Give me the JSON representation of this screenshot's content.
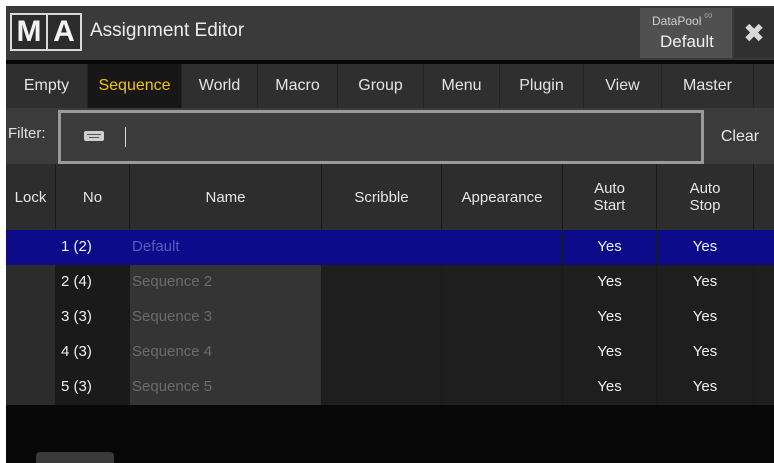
{
  "window": {
    "logo_m": "M",
    "logo_a": "A",
    "title": "Assignment Editor",
    "datapool_label": "DataPool",
    "datapool_value": "Default",
    "close_glyph": "✖"
  },
  "tabs": [
    {
      "label": "Empty",
      "active": false
    },
    {
      "label": "Sequence",
      "active": true
    },
    {
      "label": "World",
      "active": false
    },
    {
      "label": "Macro",
      "active": false
    },
    {
      "label": "Group",
      "active": false
    },
    {
      "label": "Menu",
      "active": false
    },
    {
      "label": "Plugin",
      "active": false
    },
    {
      "label": "View",
      "active": false
    },
    {
      "label": "Master",
      "active": false
    }
  ],
  "filter": {
    "label": "Filter:",
    "value": "",
    "clear_label": "Clear"
  },
  "table": {
    "columns": {
      "lock": "Lock",
      "no": "No",
      "name": "Name",
      "scribble": "Scribble",
      "appearance": "Appearance",
      "auto_start": "Auto\nStart",
      "auto_stop": "Auto\nStop"
    },
    "rows": [
      {
        "no": "1 (2)",
        "name": "Default",
        "scribble": "",
        "appearance": "",
        "auto_start": "Yes",
        "auto_stop": "Yes",
        "selected": true
      },
      {
        "no": "2 (4)",
        "name": "Sequence 2",
        "scribble": "",
        "appearance": "",
        "auto_start": "Yes",
        "auto_stop": "Yes",
        "selected": false
      },
      {
        "no": "3 (3)",
        "name": "Sequence 3",
        "scribble": "",
        "appearance": "",
        "auto_start": "Yes",
        "auto_stop": "Yes",
        "selected": false
      },
      {
        "no": "4 (3)",
        "name": "Sequence 4",
        "scribble": "",
        "appearance": "",
        "auto_start": "Yes",
        "auto_stop": "Yes",
        "selected": false
      },
      {
        "no": "5 (3)",
        "name": "Sequence 5",
        "scribble": "",
        "appearance": "",
        "auto_start": "Yes",
        "auto_stop": "Yes",
        "selected": false
      }
    ]
  },
  "colors": {
    "accent_tab": "#f3c400",
    "selection": "#0c0c8a"
  },
  "icons": {
    "keyboard": "keyboard-icon",
    "close": "close-icon"
  }
}
